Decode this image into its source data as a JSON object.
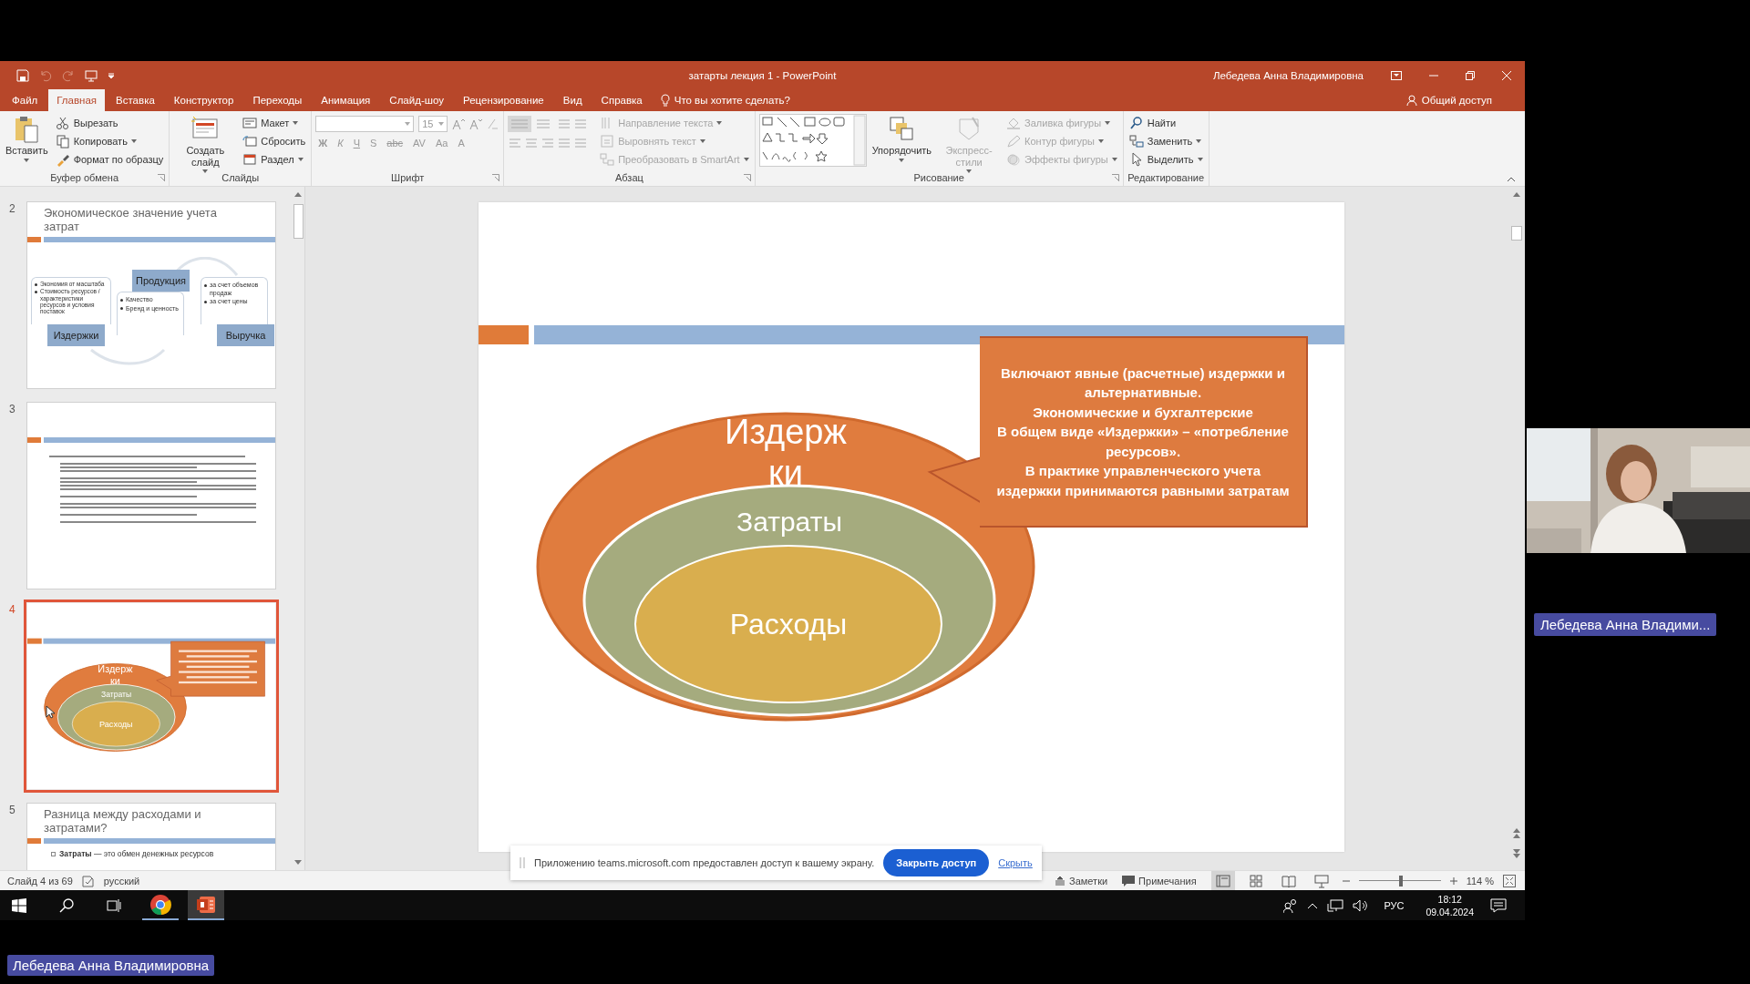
{
  "window": {
    "title": "затарты лекция 1 - PowerPoint",
    "user": "Лебедева Анна Владимировна",
    "share": "Общий доступ"
  },
  "tabs": [
    {
      "label": "Файл",
      "selected": false
    },
    {
      "label": "Главная",
      "selected": true
    },
    {
      "label": "Вставка",
      "selected": false
    },
    {
      "label": "Конструктор",
      "selected": false
    },
    {
      "label": "Переходы",
      "selected": false
    },
    {
      "label": "Анимация",
      "selected": false
    },
    {
      "label": "Слайд-шоу",
      "selected": false
    },
    {
      "label": "Рецензирование",
      "selected": false
    },
    {
      "label": "Вид",
      "selected": false
    },
    {
      "label": "Справка",
      "selected": false
    }
  ],
  "tell_me": "Что вы хотите сделать?",
  "ribbon": [
    {
      "kind": "clipboard",
      "label": "Буфер обмена",
      "big": [
        {
          "label": "Вставить",
          "kind": "paste",
          "dropdown": true,
          "disabled": false
        }
      ],
      "items": [
        {
          "label": "Вырезать",
          "kind": "cut",
          "dropdown": false,
          "disabled": false
        },
        {
          "label": "Копировать",
          "kind": "copy",
          "dropdown": true,
          "disabled": false
        },
        {
          "label": "Формат по образцу",
          "kind": "brush",
          "dropdown": false,
          "disabled": false
        }
      ]
    },
    {
      "kind": "slides",
      "label": "Слайды",
      "big": [
        {
          "label": "Создать слайд",
          "kind": "newslide",
          "dropdown": true,
          "disabled": false
        }
      ],
      "items": [
        {
          "label": "Макет",
          "kind": "layout",
          "dropdown": true,
          "disabled": false
        },
        {
          "label": "Сбросить",
          "kind": "reset",
          "dropdown": false,
          "disabled": false
        },
        {
          "label": "Раздел",
          "kind": "section",
          "dropdown": true,
          "disabled": false
        }
      ]
    },
    {
      "kind": "font",
      "label": "Шрифт",
      "size": "15",
      "format": [
        "Ж",
        "К",
        "Ч",
        "S",
        "abc",
        "AV",
        "Aa",
        "A"
      ]
    },
    {
      "kind": "paragraph",
      "label": "Абзац",
      "items": [
        {
          "label": "Направление текста",
          "kind": "direction",
          "dropdown": true,
          "disabled": true
        },
        {
          "label": "Выровнять текст",
          "kind": "align",
          "dropdown": true,
          "disabled": true
        },
        {
          "label": "Преобразовать в SmartArt",
          "kind": "smartart",
          "dropdown": true,
          "disabled": true
        }
      ]
    },
    {
      "kind": "drawing",
      "label": "Рисование",
      "big": [
        {
          "label": "Упорядочить",
          "kind": "arrange",
          "dropdown": true,
          "disabled": false
        },
        {
          "label": "Экспресс-стили",
          "kind": "styles",
          "dropdown": true,
          "disabled": true
        }
      ],
      "items": [
        {
          "label": "Заливка фигуры",
          "kind": "fill",
          "dropdown": true,
          "disabled": true
        },
        {
          "label": "Контур фигуры",
          "kind": "outline",
          "dropdown": true,
          "disabled": true
        },
        {
          "label": "Эффекты фигуры",
          "kind": "effects",
          "dropdown": true,
          "disabled": true
        }
      ]
    },
    {
      "kind": "editing",
      "label": "Редактирование",
      "items": [
        {
          "label": "Найти",
          "kind": "find",
          "dropdown": false,
          "disabled": false
        },
        {
          "label": "Заменить",
          "kind": "replace",
          "dropdown": true,
          "disabled": false
        },
        {
          "label": "Выделить",
          "kind": "select",
          "dropdown": true,
          "disabled": false
        }
      ]
    }
  ],
  "thumbnails": [
    {
      "number": "2",
      "selected": false,
      "kind": "diagram",
      "title": "Экономическое значение учета затрат",
      "boxes": [
        {
          "label": "Издержки",
          "bullets": [
            "Экономия от масштаба",
            "Стоимость ресурсов / характеристики ресурсов и условия поставок"
          ]
        },
        {
          "label": "Продукция",
          "bullets": [
            "Качество",
            "Бренд и ценность"
          ]
        },
        {
          "label": "Выручка",
          "bullets": [
            "за счет объемов продаж",
            "за счет цены"
          ]
        }
      ]
    },
    {
      "number": "3",
      "selected": false,
      "kind": "text"
    },
    {
      "number": "4",
      "selected": true,
      "kind": "ellipses",
      "outer_label_lines": [
        "Издерж",
        "ки"
      ],
      "middle_label": "Затраты",
      "inner_label": "Расходы"
    },
    {
      "number": "5",
      "selected": false,
      "kind": "definition",
      "title": "Разница между расходами и затратами?",
      "text": "**Затраты** — это обмен денежных ресурсов"
    }
  ],
  "slide": {
    "outer_label_lines": [
      "Издерж",
      "ки"
    ],
    "middle_label": "Затраты",
    "inner_label": "Расходы",
    "callout_lines": [
      "Включают явные (расчетные) издержки и",
      "альтернативные.",
      "Экономические и бухгалтерские",
      "В общем виде «Издержки» – «потребление",
      "ресурсов».",
      "В практике управленческого учета",
      "издержки принимаются равными затратам"
    ]
  },
  "share_bar": {
    "message": "Приложению teams.microsoft.com предоставлен доступ к вашему экрану.",
    "button": "Закрыть доступ",
    "link": "Скрыть"
  },
  "status": {
    "slide": "Слайд 4 из 69",
    "language": "русский",
    "notes": "Заметки",
    "comments": "Примечания",
    "views": [
      {
        "kind": "normal",
        "selected": true
      },
      {
        "kind": "sorter",
        "selected": false
      },
      {
        "kind": "reading",
        "selected": false
      },
      {
        "kind": "slideshow",
        "selected": false
      }
    ],
    "zoom": {
      "level": 0.52,
      "reading": "114 %"
    }
  },
  "taskbar": {
    "apps": [
      {
        "kind": "chrome",
        "selected": false
      },
      {
        "kind": "powerpoint",
        "selected": true
      }
    ],
    "language": "РУС",
    "time": "18:12",
    "date": "09.04.2024"
  },
  "video": {
    "name_label": "Лебедева Анна Владими...",
    "presenter": "Лебедева Анна Владимировна"
  }
}
